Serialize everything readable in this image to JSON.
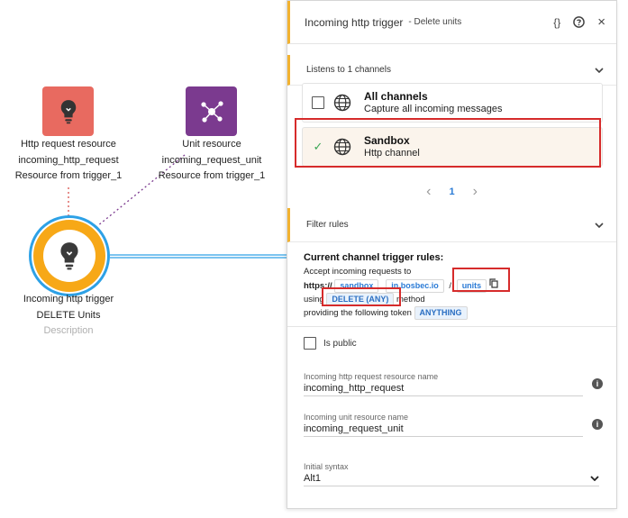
{
  "canvas": {
    "nodes": [
      {
        "id": "http_resource",
        "lines": [
          "Http request resource",
          "incoming_http_request",
          "Resource from trigger_1"
        ],
        "color": "#e86a60"
      },
      {
        "id": "unit_resource",
        "lines": [
          "Unit resource",
          "incoming_request_unit",
          "Resource from trigger_1"
        ],
        "color": "#7b3a8f"
      },
      {
        "id": "trigger",
        "lines": [
          "Incoming http trigger",
          "DELETE Units"
        ],
        "description": "Description",
        "ring_color": "#f7a817",
        "border_color": "#2da1e6"
      }
    ]
  },
  "panel": {
    "title": "Incoming http trigger",
    "subtitle": "- Delete units",
    "header_icons": [
      "code-braces-icon",
      "help-icon",
      "close-icon"
    ],
    "code_icon_text": "{}",
    "close_text": "×",
    "channels_section": "Listens to 1 channels",
    "channels": [
      {
        "title": "All channels",
        "subtitle": "Capture all incoming messages",
        "selected": false
      },
      {
        "title": "Sandbox",
        "subtitle": "Http channel",
        "selected": true
      }
    ],
    "pager": {
      "prev": "‹",
      "current": "1",
      "next": "›"
    },
    "filter_section": "Filter rules",
    "rules": {
      "heading": "Current channel trigger rules:",
      "accept_text": "Accept incoming requests to",
      "proto": "https://",
      "sub": "sandbox",
      "dot": ".",
      "domain": "in.bosbec.io",
      "slash": "/",
      "path": "units",
      "using": "using",
      "method": "DELETE (ANY)",
      "method_suffix": "method",
      "token_text": "providing the following token",
      "token": "ANYTHING"
    },
    "is_public_label": "Is public",
    "fields": [
      {
        "label": "Incoming http request resource name",
        "value": "incoming_http_request"
      },
      {
        "label": "Incoming unit resource name",
        "value": "incoming_request_unit"
      }
    ],
    "syntax": {
      "label": "Initial syntax",
      "value": "Alt1"
    }
  },
  "colors": {
    "accent": "#f2b230",
    "link": "#2b7bd6",
    "highlight": "#d62b2b",
    "check": "#3aa655"
  }
}
